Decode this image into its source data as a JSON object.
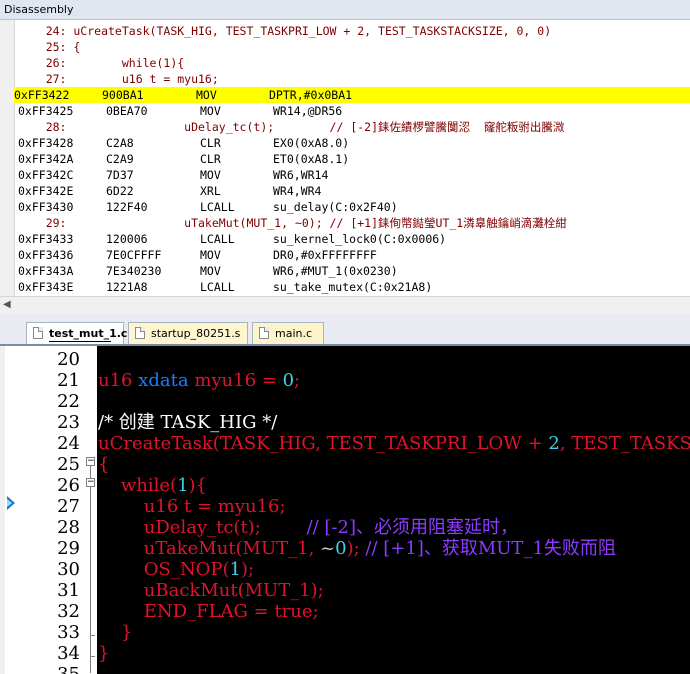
{
  "disassembly": {
    "title": "Disassembly",
    "lines": [
      {
        "type": "src",
        "text": "    24: uCreateTask(TASK_HIG, TEST_TASKPRI_LOW + 2, TEST_TASKSTACKSIZE, 0, 0)"
      },
      {
        "type": "src",
        "text": "    25: {"
      },
      {
        "type": "src",
        "text": "    26:        while(1){"
      },
      {
        "type": "src",
        "text": "    27:        u16 t = myu16;"
      },
      {
        "type": "asm",
        "addr": "0xFF3422",
        "hex": "900BA1",
        "mn": "MOV",
        "op": "DPTR,#0x0BA1",
        "hl": true
      },
      {
        "type": "asm",
        "addr": "0xFF3425",
        "hex": "0BEA70",
        "mn": "MOV",
        "op": "WR14,@DR56"
      },
      {
        "type": "src",
        "text": "    28:                 uDelay_tc(t);        // [-2]銇佐績椤譬騰闅涊  窿舵粄驸出騰溦"
      },
      {
        "type": "asm",
        "addr": "0xFF3428",
        "hex": "C2A8",
        "mn": "CLR",
        "op": "EX0(0xA8.0)"
      },
      {
        "type": "asm",
        "addr": "0xFF342A",
        "hex": "C2A9",
        "mn": "CLR",
        "op": "ET0(0xA8.1)"
      },
      {
        "type": "asm",
        "addr": "0xFF342C",
        "hex": "7D37",
        "mn": "MOV",
        "op": "WR6,WR14"
      },
      {
        "type": "asm",
        "addr": "0xFF342E",
        "hex": "6D22",
        "mn": "XRL",
        "op": "WR4,WR4"
      },
      {
        "type": "asm",
        "addr": "0xFF3430",
        "hex": "122F40",
        "mn": "LCALL",
        "op": "su_delay(C:0x2F40)"
      },
      {
        "type": "src",
        "text": "    29:                 uTakeMut(MUT_1, ~0); // [+1]銇侚幣鐑瑩UT_1潾辠触鑰峭滴灘栓紺"
      },
      {
        "type": "asm",
        "addr": "0xFF3433",
        "hex": "120006",
        "mn": "LCALL",
        "op": "su_kernel_lock0(C:0x0006)"
      },
      {
        "type": "asm",
        "addr": "0xFF3436",
        "hex": "7E0CFFFF",
        "mn": "MOV",
        "op": "DR0,#0xFFFFFFFF"
      },
      {
        "type": "asm",
        "addr": "0xFF343A",
        "hex": "7E340230",
        "mn": "MOV",
        "op": "WR6,#MUT_1(0x0230)"
      },
      {
        "type": "asm",
        "addr": "0xFF343E",
        "hex": "1221A8",
        "mn": "LCALL",
        "op": "su_take_mutex(C:0x21A8)"
      }
    ]
  },
  "tabs": [
    {
      "label": "test_mut_1.c",
      "active": true,
      "style": "active"
    },
    {
      "label": "startup_80251.s",
      "active": false,
      "style": "y1"
    },
    {
      "label": "main.c",
      "active": false,
      "style": "y2"
    }
  ],
  "editor": {
    "colors": {
      "background": "#000000",
      "keyword": "#e0132d",
      "type": "#1e7bff",
      "comment": "#8c3cff",
      "number": "#3fd0e6"
    },
    "current_line": 27,
    "lines": [
      {
        "num": "20",
        "parts": []
      },
      {
        "num": "21",
        "parts": [
          {
            "c": "k-red",
            "t": "u16 "
          },
          {
            "c": "k-blue",
            "t": "xdata "
          },
          {
            "c": "k-red",
            "t": "myu16 = "
          },
          {
            "c": "k-cyan",
            "t": "0"
          },
          {
            "c": "k-red",
            "t": ";"
          }
        ]
      },
      {
        "num": "22",
        "parts": []
      },
      {
        "num": "23",
        "parts": [
          {
            "c": "k-white",
            "t": "/* 创建 TASK_HIG */"
          }
        ]
      },
      {
        "num": "24",
        "parts": [
          {
            "c": "k-red",
            "t": "uCreateTask(TASK_HIG, TEST_TASKPRI_LOW + "
          },
          {
            "c": "k-cyan",
            "t": "2"
          },
          {
            "c": "k-red",
            "t": ", TEST_TASKS"
          }
        ]
      },
      {
        "num": "25",
        "parts": [
          {
            "c": "k-red",
            "t": "{"
          }
        ]
      },
      {
        "num": "26",
        "parts": [
          {
            "c": "k-red",
            "t": "    while("
          },
          {
            "c": "k-cyan",
            "t": "1"
          },
          {
            "c": "k-red",
            "t": "){"
          }
        ]
      },
      {
        "num": "27",
        "parts": [
          {
            "c": "k-red",
            "t": "        u16 t = myu16;"
          }
        ]
      },
      {
        "num": "28",
        "parts": [
          {
            "c": "k-red",
            "t": "        uDelay_tc(t);        "
          },
          {
            "c": "k-purp",
            "t": "// [-2]、必须用阻塞延时，"
          }
        ]
      },
      {
        "num": "29",
        "parts": [
          {
            "c": "k-red",
            "t": "        uTakeMut(MUT_1, "
          },
          {
            "c": "k-gray",
            "t": "~"
          },
          {
            "c": "k-cyan",
            "t": "0"
          },
          {
            "c": "k-red",
            "t": "); "
          },
          {
            "c": "k-purp",
            "t": "// [+1]、获取MUT_1失败而阻"
          }
        ]
      },
      {
        "num": "30",
        "parts": [
          {
            "c": "k-red",
            "t": "        OS_NOP("
          },
          {
            "c": "k-cyan",
            "t": "1"
          },
          {
            "c": "k-red",
            "t": ");"
          }
        ]
      },
      {
        "num": "31",
        "parts": [
          {
            "c": "k-red",
            "t": "        uBackMut(MUT_1);"
          }
        ]
      },
      {
        "num": "32",
        "parts": [
          {
            "c": "k-red",
            "t": "        END_FLAG = "
          },
          {
            "c": "k-red",
            "t": "true"
          },
          {
            "c": "k-red",
            "t": ";"
          }
        ]
      },
      {
        "num": "33",
        "parts": [
          {
            "c": "k-red",
            "t": "    }"
          }
        ]
      },
      {
        "num": "34",
        "parts": [
          {
            "c": "k-red",
            "t": "}"
          }
        ]
      },
      {
        "num": "35",
        "parts": []
      }
    ]
  }
}
